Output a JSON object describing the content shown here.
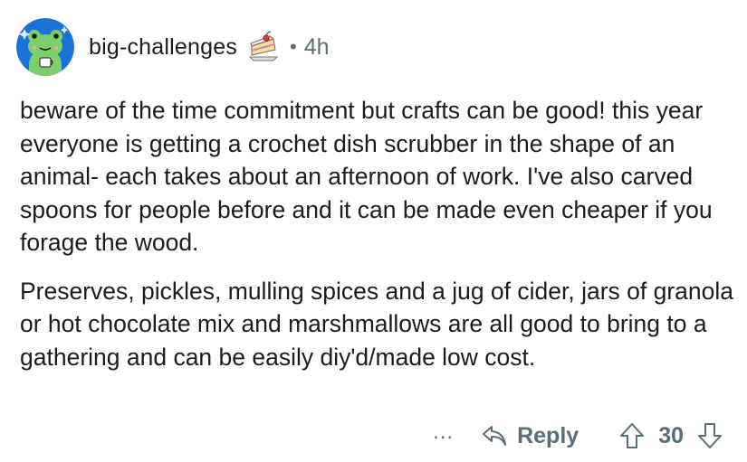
{
  "comment": {
    "author": "big-challenges",
    "separator": "•",
    "time": "4h",
    "paragraphs": [
      "beware of the time commitment but crafts can be good! this year everyone is getting a crochet dish scrubber in the shape of an animal- each takes about an afternoon of work. I've also carved spoons for people before and it can be made even cheaper if you forage the wood.",
      "Preserves, pickles, mulling spices and a jug of cider, jars of granola or hot chocolate mix and marshmallows are all good to bring to a gathering and can be easily diy'd/made low cost."
    ]
  },
  "actions": {
    "more_label": "...",
    "reply_label": "Reply",
    "score": "30"
  },
  "icons": {
    "avatar": "frog-avatar-icon",
    "flair": "cake-slice-icon",
    "reply": "reply-arrow-icon",
    "upvote": "upvote-arrow-icon",
    "downvote": "downvote-arrow-icon"
  },
  "colors": {
    "text": "#1c1c1c",
    "meta": "#576f76",
    "avatar_bg": "#0079d3",
    "frog": "#6fc276"
  }
}
